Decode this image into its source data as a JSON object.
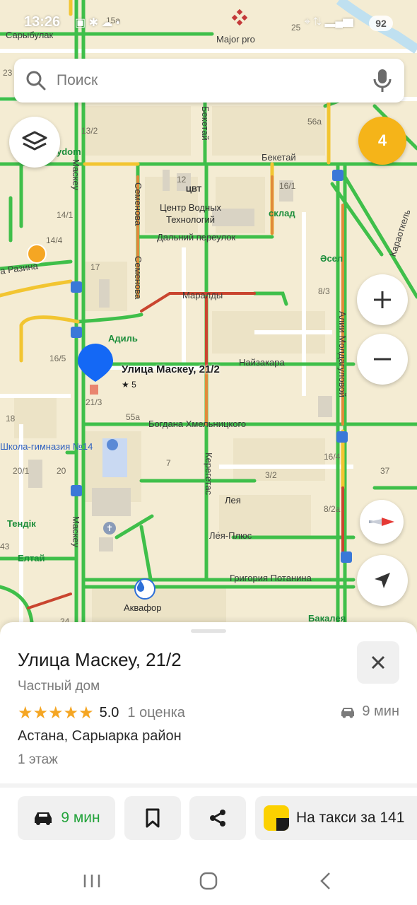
{
  "status_bar": {
    "time": "13:26",
    "battery": "92"
  },
  "search": {
    "placeholder": "Поиск"
  },
  "map": {
    "traffic_level": "4",
    "top_labels": {
      "sarybulak": "Сарыбулак",
      "major_pro": "Major pro",
      "num_25": "25",
      "num_15a": "15а",
      "num_23": "23"
    },
    "streets": {
      "beketai": "Бекетай",
      "beketai_v": "Бекетай",
      "maskeu": "Маскеу",
      "maskeu_low": "Маскеу",
      "semenova": "Семенова",
      "semenova2": "Семенова",
      "dalniy": "Дальний переулок",
      "maraldy": "Маралды",
      "naizakara": "Найзакара",
      "khmelnitskogo": "Богдана Хмельницкого",
      "keregetas": "Керегетас",
      "potanina": "Григория Потанина",
      "moldagulova": "Алии Молдагуловой",
      "karaotkel": "Караоткель",
      "razina": "а Разина",
      "lea_plus": "Ле́я-Плюс"
    },
    "pois": {
      "cvt_short": "ЦВТ",
      "cvt": "Центр Водных",
      "cvt2": "Технологий",
      "sklad": "склад",
      "asel": "Әсел",
      "adil": "Адиль",
      "school": "Школа-гимназия №14",
      "tendik": "Тендік",
      "eltai": "Елтай",
      "akvafor": "Аквафор",
      "bakaleya": "Бакалея",
      "leya": "Лея",
      "dom": "ydom"
    },
    "house_numbers": [
      "56а",
      "13/2",
      "12",
      "16/1",
      "14/1",
      "14/4",
      "17",
      "8/3",
      "16/5",
      "21/3",
      "55а",
      "18",
      "16/4",
      "20/1",
      "20",
      "7",
      "3/2",
      "37",
      "8/2а",
      "43",
      "24"
    ],
    "marker": {
      "title": "Улица Маскеу, 21/2",
      "rating": "★ 5"
    }
  },
  "place": {
    "title": "Улица Маскеу, 21/2",
    "category": "Частный дом",
    "stars": "★★★★★",
    "score": "5.0",
    "reviews": "1 оценка",
    "drive_time": "9 мин",
    "address": "Астана, Сарыарка район",
    "floors": "1 этаж"
  },
  "actions": {
    "route_time": "9 мин",
    "taxi": "На такси за 141"
  },
  "colors": {
    "map_bg": "#f4ecd3",
    "road_green": "#3fbf4a",
    "road_yellow": "#f2c531",
    "road_red": "#c9452f",
    "marker_blue": "#1468f5",
    "traffic_badge": "#f5b419",
    "route_green": "#23a33b",
    "star": "#f5a623"
  }
}
